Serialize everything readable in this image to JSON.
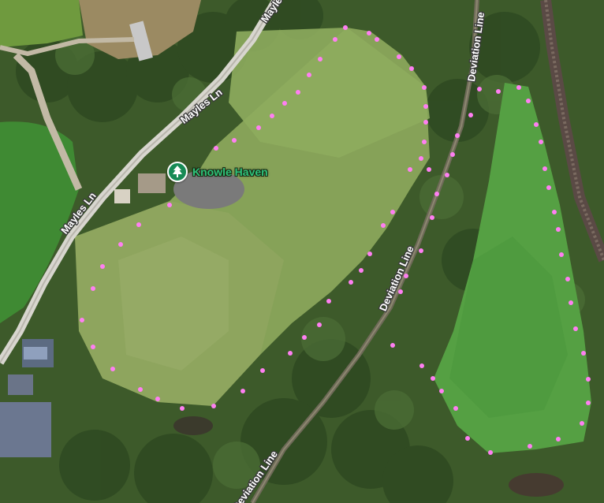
{
  "map": {
    "type": "satellite",
    "roads": [
      {
        "id": "mayles-ln-north",
        "label": "Mayles Ln"
      },
      {
        "id": "mayles-ln-south",
        "label": "Mayles Ln"
      },
      {
        "id": "deviation-line-top",
        "label": "Deviation Line"
      },
      {
        "id": "deviation-line-mid",
        "label": "Deviation Line"
      },
      {
        "id": "deviation-line-bottom",
        "label": "Deviation Line"
      },
      {
        "id": "mayles-top",
        "label": "Mayles"
      }
    ],
    "poi": {
      "label": "Knowle Haven",
      "icon": "tree-icon",
      "color": "#178a55"
    },
    "boundary": {
      "style": "dotted",
      "color": "#ff7ff2"
    }
  }
}
